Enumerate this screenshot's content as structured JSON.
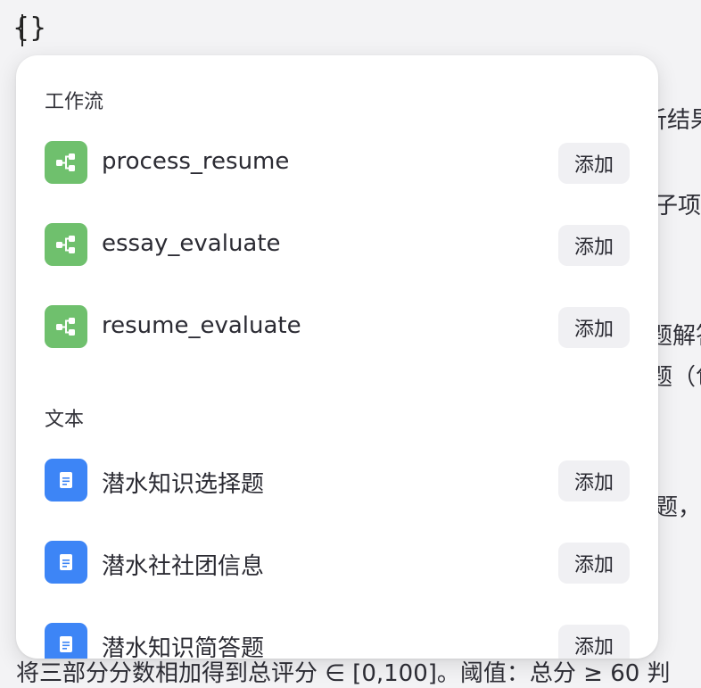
{
  "background": {
    "brace": "{}",
    "fragments": [
      "析结果",
      "子项",
      "题解答",
      "题（包",
      "题，等"
    ],
    "bottom_line": "将三部分分数相加得到总评分 ∈ [0,100]。阈值：总分 ≥ 60 判"
  },
  "popup": {
    "workflow_section": {
      "title": "工作流",
      "items": [
        {
          "label": "process_resume",
          "button": "添加",
          "icon": "workflow-icon"
        },
        {
          "label": "essay_evaluate",
          "button": "添加",
          "icon": "workflow-icon"
        },
        {
          "label": "resume_evaluate",
          "button": "添加",
          "icon": "workflow-icon"
        }
      ]
    },
    "text_section": {
      "title": "文本",
      "items": [
        {
          "label": "潜水知识选择题",
          "button": "添加",
          "icon": "document-icon"
        },
        {
          "label": "潜水社社团信息",
          "button": "添加",
          "icon": "document-icon"
        },
        {
          "label": "潜水知识简答题",
          "button": "添加",
          "icon": "document-icon"
        }
      ]
    }
  },
  "colors": {
    "workflow_icon_bg": "#6fc06d",
    "document_icon_bg": "#3d85f6",
    "button_bg": "#f0f0f3"
  }
}
